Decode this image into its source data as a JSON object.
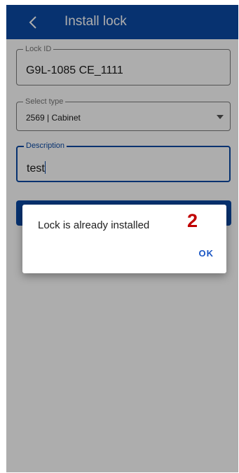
{
  "appbar": {
    "title": "Install lock",
    "back_icon": "chevron-left-icon"
  },
  "form": {
    "lock_id": {
      "label": "Lock ID",
      "value": "G9L-1085 CE_1111"
    },
    "type": {
      "label": "Select type",
      "value": "2569 | Cabinet",
      "icon": "dropdown-arrow-icon"
    },
    "description": {
      "label": "Description",
      "value": "test"
    }
  },
  "dialog": {
    "message": "Lock is already installed",
    "badge": "2",
    "ok_label": "OK"
  },
  "colors": {
    "primary": "#0b4aa6",
    "badge": "#c00000",
    "dialog_button": "#1a56c4"
  }
}
